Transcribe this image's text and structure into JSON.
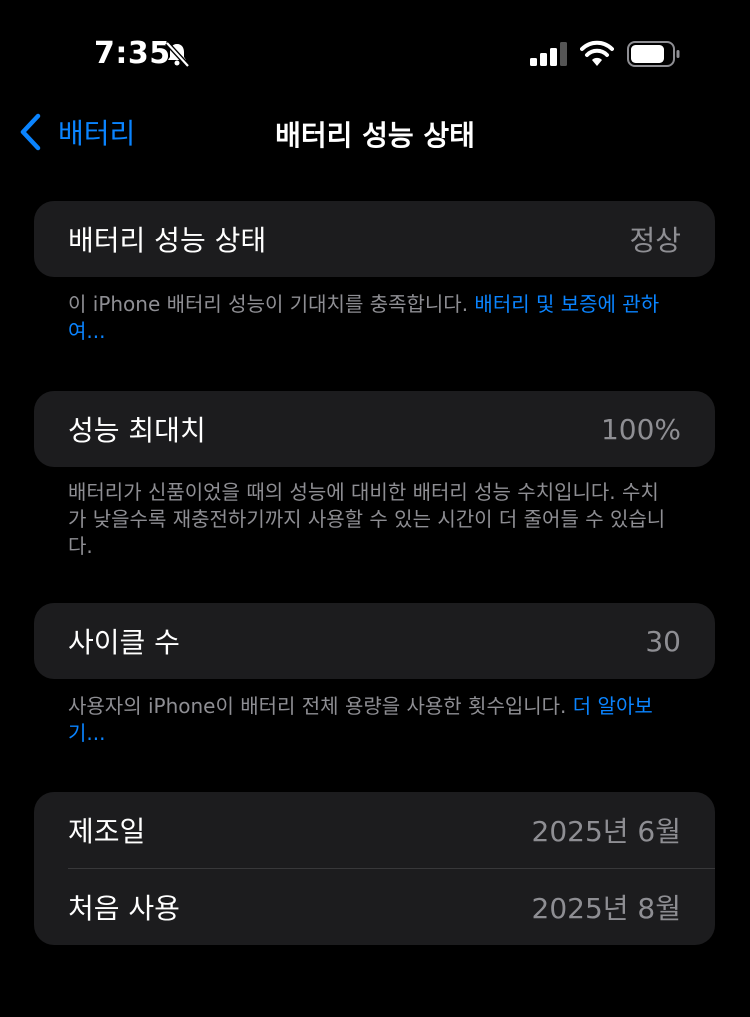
{
  "colors": {
    "background": "#000000",
    "card": "#1c1c1e",
    "accent": "#0a84ff",
    "secondary_text": "#8e8e93",
    "separator": "#38383a"
  },
  "status_bar": {
    "time": "7:35",
    "icons": [
      "bell-slash-icon",
      "cellular-signal-icon",
      "wifi-icon",
      "battery-icon"
    ]
  },
  "nav": {
    "back_label": "배터리",
    "title": "배터리 성능 상태"
  },
  "health": {
    "label": "배터리 성능 상태",
    "value": "정상",
    "footnote_text": "이 iPhone 배터리 성능이 기대치를 충족합니다. ",
    "footnote_link": "배터리 및 보증에 관하여..."
  },
  "max_capacity": {
    "label": "성능 최대치",
    "value": "100%",
    "footnote_text": "배터리가 신품이었을 때의 성능에 대비한 배터리 성능 수치입니다. 수치가 낮을수록 재충전하기까지 사용할 수 있는 시간이 더 줄어들 수 있습니다."
  },
  "cycle_count": {
    "label": "사이클 수",
    "value": "30",
    "footnote_text": "사용자의 iPhone이 배터리 전체 용량을 사용한 횟수입니다. ",
    "footnote_link": "더 알아보기..."
  },
  "dates": {
    "manufacture_label": "제조일",
    "manufacture_value": "2025년 6월",
    "first_use_label": "처음 사용",
    "first_use_value": "2025년 8월"
  }
}
